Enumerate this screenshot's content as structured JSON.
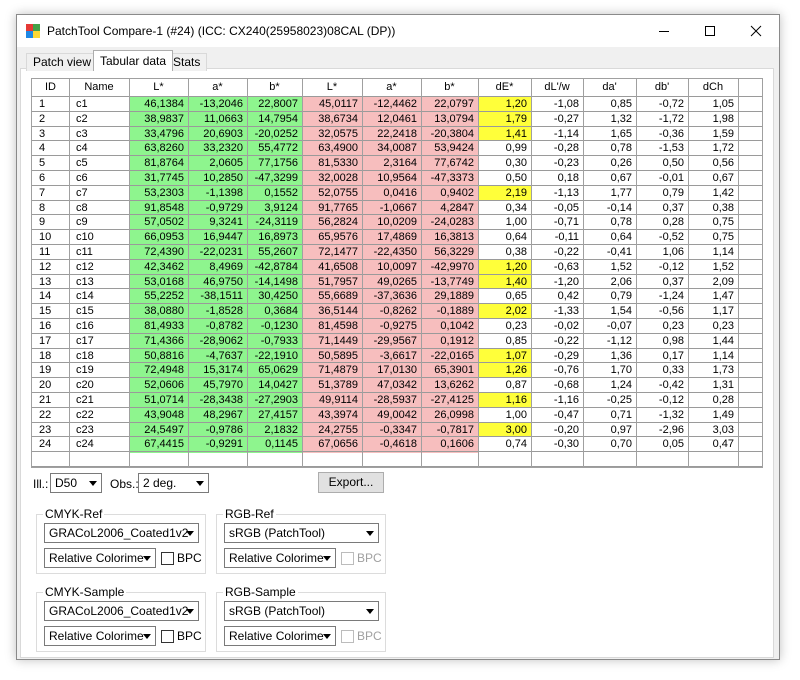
{
  "window": {
    "title": "PatchTool Compare-1 (#24) (ICC: CX240(25958023)08CAL (DP))",
    "controls": [
      "minimize",
      "maximize",
      "close"
    ]
  },
  "tabs": [
    "Patch view",
    "Tabular data",
    "Stats"
  ],
  "active_tab": "Tabular data",
  "colors": {
    "green_cell": "#8ef58e",
    "red_cell": "#f7bebe",
    "yellow_cell": "#ffff3a"
  },
  "table": {
    "columns": [
      "ID",
      "Name",
      "L*",
      "a*",
      "b*",
      "L*",
      "a*",
      "b*",
      "dE*",
      "dL'/w",
      "da'",
      "db'",
      "dCh"
    ],
    "rows": [
      [
        "1",
        "c1",
        "46,1384",
        "-13,2046",
        "22,8007",
        "45,0117",
        "-12,4462",
        "22,0797",
        "1,20",
        "-1,08",
        "0,85",
        "-0,72",
        "1,05"
      ],
      [
        "2",
        "c2",
        "38,9837",
        "11,0663",
        "14,7954",
        "38,6734",
        "12,0461",
        "13,0794",
        "1,79",
        "-0,27",
        "1,32",
        "-1,72",
        "1,98"
      ],
      [
        "3",
        "c3",
        "33,4796",
        "20,6903",
        "-20,0252",
        "32,0575",
        "22,2418",
        "-20,3804",
        "1,41",
        "-1,14",
        "1,65",
        "-0,36",
        "1,59"
      ],
      [
        "4",
        "c4",
        "63,8260",
        "33,2320",
        "55,4772",
        "63,4900",
        "34,0087",
        "53,9424",
        "0,99",
        "-0,28",
        "0,78",
        "-1,53",
        "1,72"
      ],
      [
        "5",
        "c5",
        "81,8764",
        "2,0605",
        "77,1756",
        "81,5330",
        "2,3164",
        "77,6742",
        "0,30",
        "-0,23",
        "0,26",
        "0,50",
        "0,56"
      ],
      [
        "6",
        "c6",
        "31,7745",
        "10,2850",
        "-47,3299",
        "32,0028",
        "10,9564",
        "-47,3373",
        "0,50",
        "0,18",
        "0,67",
        "-0,01",
        "0,67"
      ],
      [
        "7",
        "c7",
        "53,2303",
        "-1,1398",
        "0,1552",
        "52,0755",
        "0,0416",
        "0,9402",
        "2,19",
        "-1,13",
        "1,77",
        "0,79",
        "1,42"
      ],
      [
        "8",
        "c8",
        "91,8548",
        "-0,9729",
        "3,9124",
        "91,7765",
        "-1,0667",
        "4,2847",
        "0,34",
        "-0,05",
        "-0,14",
        "0,37",
        "0,38"
      ],
      [
        "9",
        "c9",
        "57,0502",
        "9,3241",
        "-24,3119",
        "56,2824",
        "10,0209",
        "-24,0283",
        "1,00",
        "-0,71",
        "0,78",
        "0,28",
        "0,75"
      ],
      [
        "10",
        "c10",
        "66,0953",
        "16,9447",
        "16,8973",
        "65,9576",
        "17,4869",
        "16,3813",
        "0,64",
        "-0,11",
        "0,64",
        "-0,52",
        "0,75"
      ],
      [
        "11",
        "c11",
        "72,4390",
        "-22,0231",
        "55,2607",
        "72,1477",
        "-22,4350",
        "56,3229",
        "0,38",
        "-0,22",
        "-0,41",
        "1,06",
        "1,14"
      ],
      [
        "12",
        "c12",
        "42,3462",
        "8,4969",
        "-42,8784",
        "41,6508",
        "10,0097",
        "-42,9970",
        "1,20",
        "-0,63",
        "1,52",
        "-0,12",
        "1,52"
      ],
      [
        "13",
        "c13",
        "53,0168",
        "46,9750",
        "-14,1498",
        "51,7957",
        "49,0265",
        "-13,7749",
        "1,40",
        "-1,20",
        "2,06",
        "0,37",
        "2,09"
      ],
      [
        "14",
        "c14",
        "55,2252",
        "-38,1511",
        "30,4250",
        "55,6689",
        "-37,3636",
        "29,1889",
        "0,65",
        "0,42",
        "0,79",
        "-1,24",
        "1,47"
      ],
      [
        "15",
        "c15",
        "38,0880",
        "-1,8528",
        "0,3684",
        "36,5144",
        "-0,8262",
        "-0,1889",
        "2,02",
        "-1,33",
        "1,54",
        "-0,56",
        "1,17"
      ],
      [
        "16",
        "c16",
        "81,4933",
        "-0,8782",
        "-0,1230",
        "81,4598",
        "-0,9275",
        "0,1042",
        "0,23",
        "-0,02",
        "-0,07",
        "0,23",
        "0,23"
      ],
      [
        "17",
        "c17",
        "71,4366",
        "-28,9062",
        "-0,7933",
        "71,1449",
        "-29,9567",
        "0,1912",
        "0,85",
        "-0,22",
        "-1,12",
        "0,98",
        "1,44"
      ],
      [
        "18",
        "c18",
        "50,8816",
        "-4,7637",
        "-22,1910",
        "50,5895",
        "-3,6617",
        "-22,0165",
        "1,07",
        "-0,29",
        "1,36",
        "0,17",
        "1,14"
      ],
      [
        "19",
        "c19",
        "72,4948",
        "15,3174",
        "65,0629",
        "71,4879",
        "17,0130",
        "65,3901",
        "1,26",
        "-0,76",
        "1,70",
        "0,33",
        "1,73"
      ],
      [
        "20",
        "c20",
        "52,0606",
        "45,7970",
        "14,0427",
        "51,3789",
        "47,0342",
        "13,6262",
        "0,87",
        "-0,68",
        "1,24",
        "-0,42",
        "1,31"
      ],
      [
        "21",
        "c21",
        "51,0714",
        "-28,3438",
        "-27,2903",
        "49,9114",
        "-28,5937",
        "-27,4125",
        "1,16",
        "-1,16",
        "-0,25",
        "-0,12",
        "0,28"
      ],
      [
        "22",
        "c22",
        "43,9048",
        "48,2967",
        "27,4157",
        "43,3974",
        "49,0042",
        "26,0998",
        "1,00",
        "-0,47",
        "0,71",
        "-1,32",
        "1,49"
      ],
      [
        "23",
        "c23",
        "24,5497",
        "-0,9786",
        "2,1832",
        "24,2755",
        "-0,3347",
        "-0,7817",
        "3,00",
        "-0,20",
        "0,97",
        "-2,96",
        "3,03"
      ],
      [
        "24",
        "c24",
        "67,4415",
        "-0,9291",
        "0,1145",
        "67,0656",
        "-0,4618",
        "0,1606",
        "0,74",
        "-0,30",
        "0,70",
        "0,05",
        "0,47"
      ]
    ],
    "highlighted_de_rows": [
      1,
      2,
      3,
      7,
      12,
      13,
      15,
      18,
      19,
      21,
      23
    ]
  },
  "controls": {
    "illuminant_label": "Ill.:",
    "illuminant_value": "D50",
    "observer_label": "Obs.:",
    "observer_value": "2 deg.",
    "export_label": "Export...",
    "bpc_label": "BPC",
    "groups": [
      {
        "title": "CMYK-Ref",
        "profile": "GRACoL2006_Coated1v2",
        "intent": "Relative Colorime",
        "bpc_enabled": true
      },
      {
        "title": "RGB-Ref",
        "profile": "sRGB (PatchTool)",
        "intent": "Relative Colorime",
        "bpc_enabled": false
      },
      {
        "title": "CMYK-Sample",
        "profile": "GRACoL2006_Coated1v2",
        "intent": "Relative Colorime",
        "bpc_enabled": true
      },
      {
        "title": "RGB-Sample",
        "profile": "sRGB (PatchTool)",
        "intent": "Relative Colorime",
        "bpc_enabled": false
      }
    ]
  }
}
